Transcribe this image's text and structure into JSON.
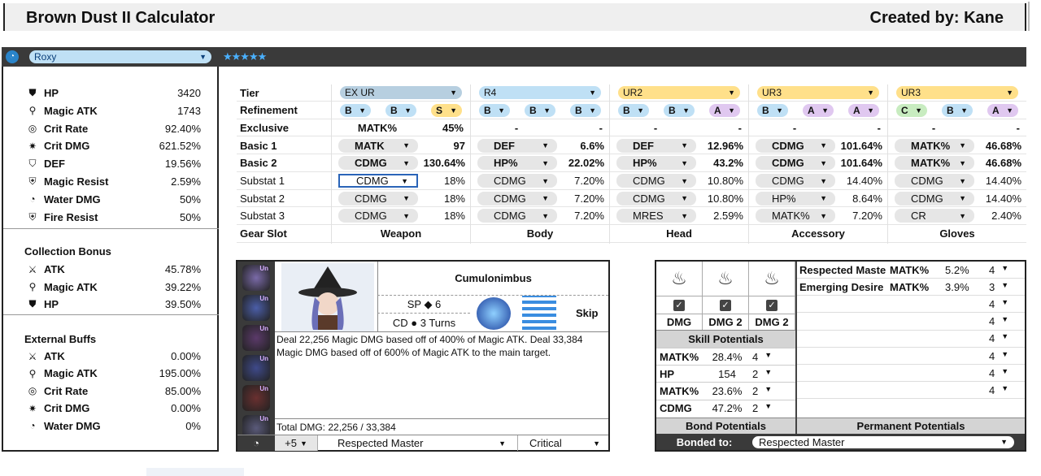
{
  "header": {
    "title": "Brown Dust II Calculator",
    "creator": "Created by: Kane"
  },
  "character": {
    "name": "Roxy",
    "stars": "★★★★★"
  },
  "stats": [
    {
      "icon": "heart-shield-icon",
      "label": "HP",
      "value": "3420"
    },
    {
      "icon": "wand-icon",
      "label": "Magic ATK",
      "value": "1743"
    },
    {
      "icon": "crit-rate-icon",
      "label": "Crit Rate",
      "value": "92.40%"
    },
    {
      "icon": "crit-dmg-icon",
      "label": "Crit DMG",
      "value": "621.52%"
    },
    {
      "icon": "shield-icon",
      "label": "DEF",
      "value": "19.56%"
    },
    {
      "icon": "magic-shield-icon",
      "label": "Magic Resist",
      "value": "2.59%"
    },
    {
      "icon": "water-icon",
      "label": "Water DMG",
      "value": "50%"
    },
    {
      "icon": "fire-shield-icon",
      "label": "Fire Resist",
      "value": "50%"
    }
  ],
  "collection": {
    "title": "Collection Bonus",
    "items": [
      {
        "icon": "sword-icon",
        "label": "ATK",
        "value": "45.78%"
      },
      {
        "icon": "wand-icon",
        "label": "Magic ATK",
        "value": "39.22%"
      },
      {
        "icon": "heart-shield-icon",
        "label": "HP",
        "value": "39.50%"
      }
    ]
  },
  "external": {
    "title": "External Buffs",
    "items": [
      {
        "icon": "sword-icon",
        "label": "ATK",
        "value": "0.00%"
      },
      {
        "icon": "wand-icon",
        "label": "Magic ATK",
        "value": "195.00%"
      },
      {
        "icon": "crit-rate-icon",
        "label": "Crit Rate",
        "value": "85.00%"
      },
      {
        "icon": "crit-dmg-icon",
        "label": "Crit DMG",
        "value": "0.00%"
      },
      {
        "icon": "water-icon",
        "label": "Water DMG",
        "value": "0%"
      }
    ]
  },
  "gear": {
    "row_labels": [
      "Tier",
      "Refinement",
      "Exclusive",
      "Basic 1",
      "Basic 2",
      "Substat 1",
      "Substat 2",
      "Substat 3",
      "Gear Slot"
    ],
    "slots": [
      {
        "slot": "Weapon",
        "tier": "EX UR",
        "tier_color": "#b7cfe0",
        "refine": [
          {
            "v": "B",
            "c": "#bfe0f5"
          },
          {
            "v": "B",
            "c": "#bfe0f5"
          },
          {
            "v": "S",
            "c": "#ffe08a"
          }
        ],
        "exclusive": [
          "MATK%",
          "45%"
        ],
        "basic1": [
          "MATK",
          "97"
        ],
        "basic2": [
          "CDMG",
          "130.64%"
        ],
        "sub1": [
          "CDMG",
          "18%"
        ],
        "sub2": [
          "CDMG",
          "18%"
        ],
        "sub3": [
          "CDMG",
          "18%"
        ]
      },
      {
        "slot": "Body",
        "tier": "R4",
        "tier_color": "#bfe0f5",
        "refine": [
          {
            "v": "B",
            "c": "#bfe0f5"
          },
          {
            "v": "B",
            "c": "#bfe0f5"
          },
          {
            "v": "B",
            "c": "#bfe0f5"
          }
        ],
        "exclusive": [
          "-",
          "-"
        ],
        "basic1": [
          "DEF",
          "6.6%"
        ],
        "basic2": [
          "HP%",
          "22.02%"
        ],
        "sub1": [
          "CDMG",
          "7.20%"
        ],
        "sub2": [
          "CDMG",
          "7.20%"
        ],
        "sub3": [
          "CDMG",
          "7.20%"
        ]
      },
      {
        "slot": "Head",
        "tier": "UR2",
        "tier_color": "#ffe08a",
        "refine": [
          {
            "v": "B",
            "c": "#bfe0f5"
          },
          {
            "v": "B",
            "c": "#bfe0f5"
          },
          {
            "v": "A",
            "c": "#e0c8f0"
          }
        ],
        "exclusive": [
          "-",
          "-"
        ],
        "basic1": [
          "DEF",
          "12.96%"
        ],
        "basic2": [
          "HP%",
          "43.2%"
        ],
        "sub1": [
          "CDMG",
          "10.80%"
        ],
        "sub2": [
          "CDMG",
          "10.80%"
        ],
        "sub3": [
          "MRES",
          "2.59%"
        ]
      },
      {
        "slot": "Accessory",
        "tier": "UR3",
        "tier_color": "#ffe08a",
        "refine": [
          {
            "v": "B",
            "c": "#bfe0f5"
          },
          {
            "v": "A",
            "c": "#e0c8f0"
          },
          {
            "v": "A",
            "c": "#e0c8f0"
          }
        ],
        "exclusive": [
          "-",
          "-"
        ],
        "basic1": [
          "CDMG",
          "101.64%"
        ],
        "basic2": [
          "CDMG",
          "101.64%"
        ],
        "sub1": [
          "CDMG",
          "14.40%"
        ],
        "sub2": [
          "HP%",
          "8.64%"
        ],
        "sub3": [
          "MATK%",
          "7.20%"
        ]
      },
      {
        "slot": "Gloves",
        "tier": "UR3",
        "tier_color": "#ffe08a",
        "refine": [
          {
            "v": "C",
            "c": "#c8ecc0"
          },
          {
            "v": "B",
            "c": "#bfe0f5"
          },
          {
            "v": "A",
            "c": "#e0c8f0"
          }
        ],
        "exclusive": [
          "-",
          "-"
        ],
        "basic1": [
          "MATK%",
          "46.68%"
        ],
        "basic2": [
          "MATK%",
          "46.68%"
        ],
        "sub1": [
          "CDMG",
          "14.40%"
        ],
        "sub2": [
          "CDMG",
          "14.40%"
        ],
        "sub3": [
          "CR",
          "2.40%"
        ]
      }
    ]
  },
  "skill": {
    "name": "Cumulonimbus",
    "sp": "SP ◆ 6",
    "cd": "CD ● 3 Turns",
    "skip": "Skip",
    "desc": "Deal 22,256 Magic DMG based off of 400% of Magic ATK. Deal 33,384 Magic DMG based off of 600% of Magic ATK to the main target.",
    "total": "Total DMG: 22,256 / 33,384",
    "level": "+5",
    "bond": "Respected Master",
    "mode": "Critical",
    "costume_badge": "Un"
  },
  "potentials": {
    "dmg_labels": [
      "DMG",
      "DMG 2",
      "DMG 2"
    ],
    "skill_title": "Skill Potentials",
    "skill_rows": [
      {
        "stat": "MATK%",
        "val": "28.4%",
        "lv": "4"
      },
      {
        "stat": "HP",
        "val": "154",
        "lv": "2"
      },
      {
        "stat": "MATK%",
        "val": "23.6%",
        "lv": "2"
      },
      {
        "stat": "CDMG",
        "val": "47.2%",
        "lv": "2"
      }
    ],
    "perm_rows": [
      {
        "name": "Respected Maste",
        "stat": "MATK%",
        "val": "5.2%",
        "lv": "4"
      },
      {
        "name": "Emerging Desire",
        "stat": "MATK%",
        "val": "3.9%",
        "lv": "3"
      },
      {
        "name": "",
        "stat": "",
        "val": "",
        "lv": "4"
      },
      {
        "name": "",
        "stat": "",
        "val": "",
        "lv": "4"
      },
      {
        "name": "",
        "stat": "",
        "val": "",
        "lv": "4"
      },
      {
        "name": "",
        "stat": "",
        "val": "",
        "lv": "4"
      },
      {
        "name": "",
        "stat": "",
        "val": "",
        "lv": "4"
      },
      {
        "name": "",
        "stat": "",
        "val": "",
        "lv": "4"
      }
    ],
    "bond_title": "Bond Potentials",
    "perm_title": "Permanent Potentials",
    "bonded_label": "Bonded to:",
    "bonded_value": "Respected Master"
  }
}
